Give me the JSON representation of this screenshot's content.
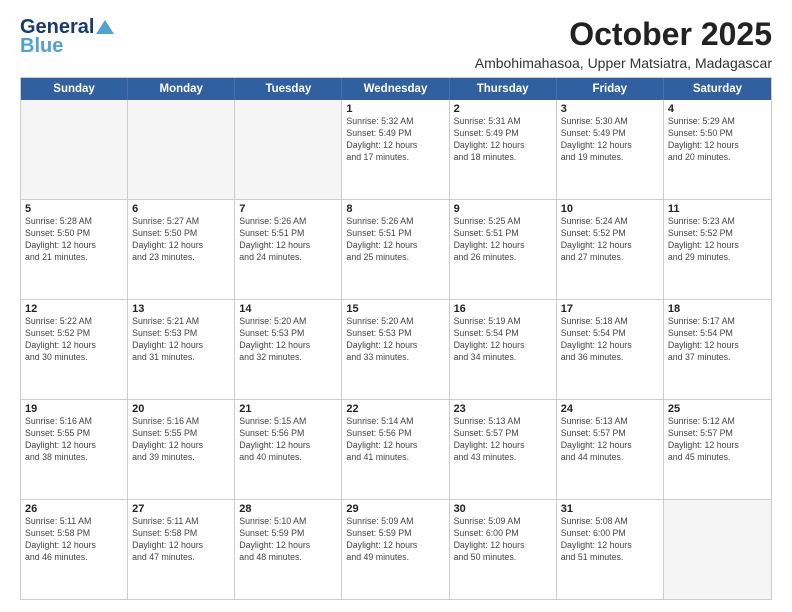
{
  "logo": {
    "line1": "General",
    "line2": "Blue"
  },
  "title": "October 2025",
  "subtitle": "Ambohimahasoa, Upper Matsiatra, Madagascar",
  "day_headers": [
    "Sunday",
    "Monday",
    "Tuesday",
    "Wednesday",
    "Thursday",
    "Friday",
    "Saturday"
  ],
  "weeks": [
    [
      {
        "num": "",
        "info": "",
        "empty": true
      },
      {
        "num": "",
        "info": "",
        "empty": true
      },
      {
        "num": "",
        "info": "",
        "empty": true
      },
      {
        "num": "1",
        "info": "Sunrise: 5:32 AM\nSunset: 5:49 PM\nDaylight: 12 hours\nand 17 minutes.",
        "empty": false
      },
      {
        "num": "2",
        "info": "Sunrise: 5:31 AM\nSunset: 5:49 PM\nDaylight: 12 hours\nand 18 minutes.",
        "empty": false
      },
      {
        "num": "3",
        "info": "Sunrise: 5:30 AM\nSunset: 5:49 PM\nDaylight: 12 hours\nand 19 minutes.",
        "empty": false
      },
      {
        "num": "4",
        "info": "Sunrise: 5:29 AM\nSunset: 5:50 PM\nDaylight: 12 hours\nand 20 minutes.",
        "empty": false
      }
    ],
    [
      {
        "num": "5",
        "info": "Sunrise: 5:28 AM\nSunset: 5:50 PM\nDaylight: 12 hours\nand 21 minutes.",
        "empty": false
      },
      {
        "num": "6",
        "info": "Sunrise: 5:27 AM\nSunset: 5:50 PM\nDaylight: 12 hours\nand 23 minutes.",
        "empty": false
      },
      {
        "num": "7",
        "info": "Sunrise: 5:26 AM\nSunset: 5:51 PM\nDaylight: 12 hours\nand 24 minutes.",
        "empty": false
      },
      {
        "num": "8",
        "info": "Sunrise: 5:26 AM\nSunset: 5:51 PM\nDaylight: 12 hours\nand 25 minutes.",
        "empty": false
      },
      {
        "num": "9",
        "info": "Sunrise: 5:25 AM\nSunset: 5:51 PM\nDaylight: 12 hours\nand 26 minutes.",
        "empty": false
      },
      {
        "num": "10",
        "info": "Sunrise: 5:24 AM\nSunset: 5:52 PM\nDaylight: 12 hours\nand 27 minutes.",
        "empty": false
      },
      {
        "num": "11",
        "info": "Sunrise: 5:23 AM\nSunset: 5:52 PM\nDaylight: 12 hours\nand 29 minutes.",
        "empty": false
      }
    ],
    [
      {
        "num": "12",
        "info": "Sunrise: 5:22 AM\nSunset: 5:52 PM\nDaylight: 12 hours\nand 30 minutes.",
        "empty": false
      },
      {
        "num": "13",
        "info": "Sunrise: 5:21 AM\nSunset: 5:53 PM\nDaylight: 12 hours\nand 31 minutes.",
        "empty": false
      },
      {
        "num": "14",
        "info": "Sunrise: 5:20 AM\nSunset: 5:53 PM\nDaylight: 12 hours\nand 32 minutes.",
        "empty": false
      },
      {
        "num": "15",
        "info": "Sunrise: 5:20 AM\nSunset: 5:53 PM\nDaylight: 12 hours\nand 33 minutes.",
        "empty": false
      },
      {
        "num": "16",
        "info": "Sunrise: 5:19 AM\nSunset: 5:54 PM\nDaylight: 12 hours\nand 34 minutes.",
        "empty": false
      },
      {
        "num": "17",
        "info": "Sunrise: 5:18 AM\nSunset: 5:54 PM\nDaylight: 12 hours\nand 36 minutes.",
        "empty": false
      },
      {
        "num": "18",
        "info": "Sunrise: 5:17 AM\nSunset: 5:54 PM\nDaylight: 12 hours\nand 37 minutes.",
        "empty": false
      }
    ],
    [
      {
        "num": "19",
        "info": "Sunrise: 5:16 AM\nSunset: 5:55 PM\nDaylight: 12 hours\nand 38 minutes.",
        "empty": false
      },
      {
        "num": "20",
        "info": "Sunrise: 5:16 AM\nSunset: 5:55 PM\nDaylight: 12 hours\nand 39 minutes.",
        "empty": false
      },
      {
        "num": "21",
        "info": "Sunrise: 5:15 AM\nSunset: 5:56 PM\nDaylight: 12 hours\nand 40 minutes.",
        "empty": false
      },
      {
        "num": "22",
        "info": "Sunrise: 5:14 AM\nSunset: 5:56 PM\nDaylight: 12 hours\nand 41 minutes.",
        "empty": false
      },
      {
        "num": "23",
        "info": "Sunrise: 5:13 AM\nSunset: 5:57 PM\nDaylight: 12 hours\nand 43 minutes.",
        "empty": false
      },
      {
        "num": "24",
        "info": "Sunrise: 5:13 AM\nSunset: 5:57 PM\nDaylight: 12 hours\nand 44 minutes.",
        "empty": false
      },
      {
        "num": "25",
        "info": "Sunrise: 5:12 AM\nSunset: 5:57 PM\nDaylight: 12 hours\nand 45 minutes.",
        "empty": false
      }
    ],
    [
      {
        "num": "26",
        "info": "Sunrise: 5:11 AM\nSunset: 5:58 PM\nDaylight: 12 hours\nand 46 minutes.",
        "empty": false
      },
      {
        "num": "27",
        "info": "Sunrise: 5:11 AM\nSunset: 5:58 PM\nDaylight: 12 hours\nand 47 minutes.",
        "empty": false
      },
      {
        "num": "28",
        "info": "Sunrise: 5:10 AM\nSunset: 5:59 PM\nDaylight: 12 hours\nand 48 minutes.",
        "empty": false
      },
      {
        "num": "29",
        "info": "Sunrise: 5:09 AM\nSunset: 5:59 PM\nDaylight: 12 hours\nand 49 minutes.",
        "empty": false
      },
      {
        "num": "30",
        "info": "Sunrise: 5:09 AM\nSunset: 6:00 PM\nDaylight: 12 hours\nand 50 minutes.",
        "empty": false
      },
      {
        "num": "31",
        "info": "Sunrise: 5:08 AM\nSunset: 6:00 PM\nDaylight: 12 hours\nand 51 minutes.",
        "empty": false
      },
      {
        "num": "",
        "info": "",
        "empty": true
      }
    ]
  ]
}
